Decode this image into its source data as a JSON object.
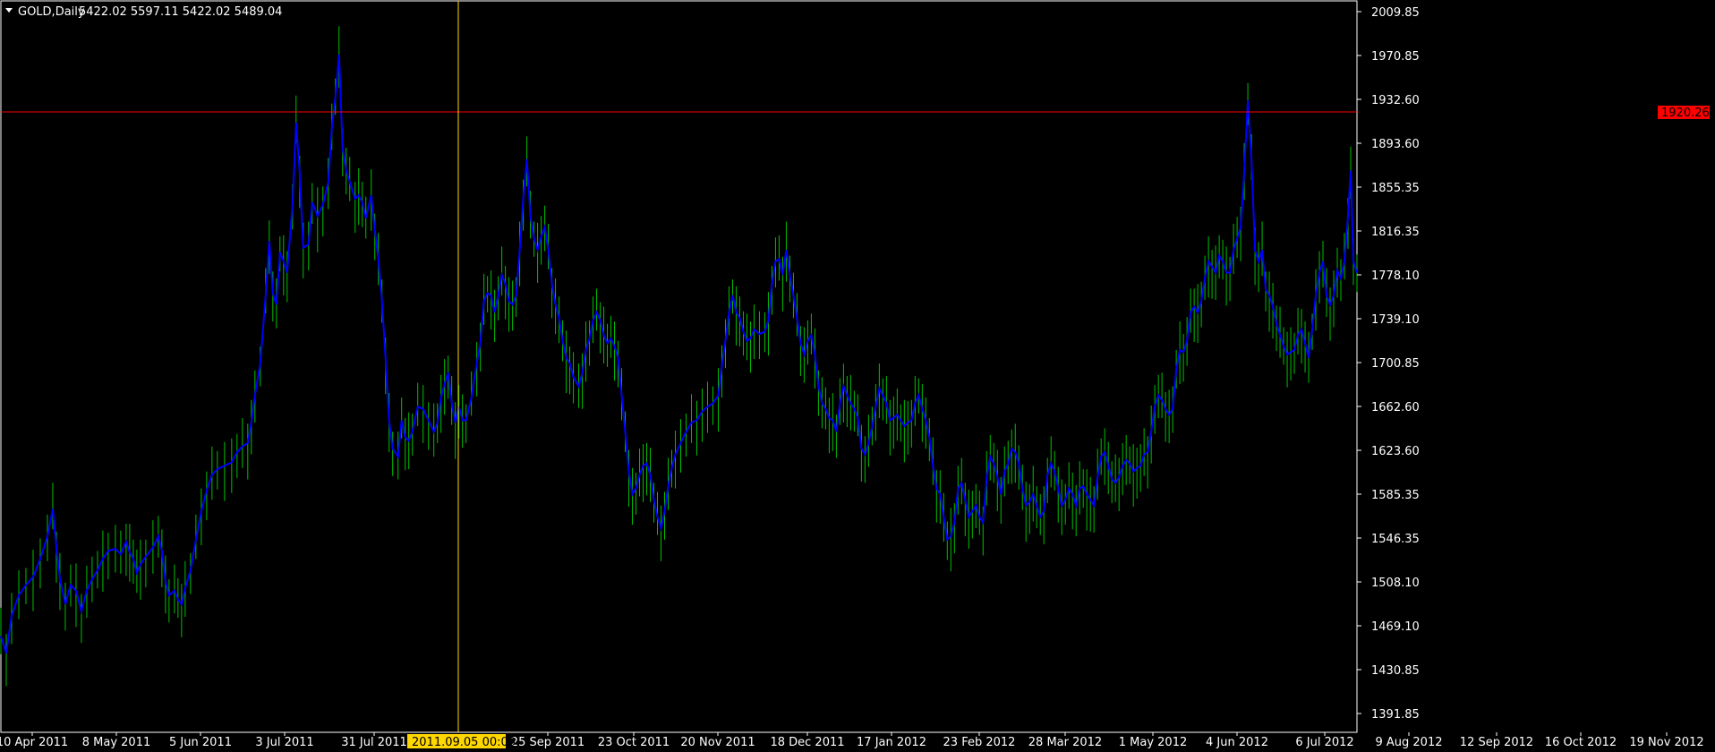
{
  "header": {
    "symbol_timeframe": "GOLD,Daily",
    "ohlc": "5422.02 5597.11 5422.02 5489.04"
  },
  "price_scale": {
    "ticks": [
      "2009.85",
      "1970.85",
      "1932.60",
      "1893.60",
      "1855.35",
      "1816.35",
      "1778.10",
      "1739.10",
      "1700.85",
      "1662.60",
      "1623.60",
      "1585.35",
      "1546.35",
      "1508.10",
      "1469.10",
      "1430.85",
      "1391.85"
    ]
  },
  "time_scale": {
    "ticks": [
      "10 Apr 2011",
      "8 May 2011",
      "5 Jun 2011",
      "3 Jul 2011",
      "31 Jul 2011",
      "25 Sep 2011",
      "23 Oct 2011",
      "20 Nov 2011",
      "18 Dec 2011",
      "17 Jan 2012",
      "23 Feb 2012",
      "28 Mar 2012",
      "1 May 2012",
      "4 Jun 2012",
      "6 Jul 2012",
      "9 Aug 2012",
      "12 Sep 2012",
      "16 Oct 2012",
      "19 Nov 2012"
    ]
  },
  "crosshair": {
    "price_label": "1920.26",
    "time_label": "2011.09.05 00:00"
  },
  "colors": {
    "background": "#000000",
    "axis": "#ffffff",
    "bars": "#00c000",
    "line": "#0000ff",
    "crosshair_h": "#ff0000",
    "crosshair_v": "#ffd700",
    "price_badge": "#ff0000",
    "time_badge": "#ffd700"
  },
  "chart_data": {
    "type": "line",
    "title": "GOLD,Daily",
    "x_start": "2011-04-01",
    "y_range": [
      1373,
      2020
    ],
    "path_points": [
      [
        0,
        1460
      ],
      [
        6,
        1445
      ],
      [
        12,
        1478
      ],
      [
        20,
        1496
      ],
      [
        28,
        1505
      ],
      [
        36,
        1512
      ],
      [
        44,
        1528
      ],
      [
        52,
        1548
      ],
      [
        58,
        1572
      ],
      [
        62,
        1538
      ],
      [
        66,
        1510
      ],
      [
        72,
        1488
      ],
      [
        78,
        1505
      ],
      [
        84,
        1500
      ],
      [
        90,
        1482
      ],
      [
        96,
        1500
      ],
      [
        102,
        1510
      ],
      [
        108,
        1518
      ],
      [
        114,
        1528
      ],
      [
        120,
        1535
      ],
      [
        128,
        1537
      ],
      [
        134,
        1532
      ],
      [
        140,
        1543
      ],
      [
        144,
        1534
      ],
      [
        148,
        1528
      ],
      [
        152,
        1516
      ],
      [
        156,
        1523
      ],
      [
        162,
        1530
      ],
      [
        170,
        1538
      ],
      [
        176,
        1548
      ],
      [
        180,
        1535
      ],
      [
        184,
        1508
      ],
      [
        188,
        1496
      ],
      [
        194,
        1500
      ],
      [
        198,
        1492
      ],
      [
        202,
        1488
      ],
      [
        206,
        1502
      ],
      [
        212,
        1518
      ],
      [
        218,
        1545
      ],
      [
        224,
        1570
      ],
      [
        230,
        1588
      ],
      [
        236,
        1602
      ],
      [
        242,
        1607
      ],
      [
        250,
        1610
      ],
      [
        258,
        1613
      ],
      [
        264,
        1622
      ],
      [
        270,
        1627
      ],
      [
        276,
        1630
      ],
      [
        280,
        1648
      ],
      [
        284,
        1672
      ],
      [
        290,
        1700
      ],
      [
        296,
        1760
      ],
      [
        300,
        1808
      ],
      [
        304,
        1762
      ],
      [
        308,
        1752
      ],
      [
        312,
        1798
      ],
      [
        316,
        1790
      ],
      [
        320,
        1780
      ],
      [
        326,
        1840
      ],
      [
        330,
        1912
      ],
      [
        334,
        1868
      ],
      [
        338,
        1802
      ],
      [
        344,
        1805
      ],
      [
        348,
        1842
      ],
      [
        354,
        1830
      ],
      [
        360,
        1840
      ],
      [
        366,
        1860
      ],
      [
        370,
        1908
      ],
      [
        374,
        1935
      ],
      [
        378,
        1972
      ],
      [
        382,
        1890
      ],
      [
        386,
        1870
      ],
      [
        390,
        1860
      ],
      [
        396,
        1845
      ],
      [
        400,
        1848
      ],
      [
        404,
        1842
      ],
      [
        408,
        1828
      ],
      [
        414,
        1848
      ],
      [
        418,
        1818
      ],
      [
        422,
        1792
      ],
      [
        426,
        1755
      ],
      [
        430,
        1705
      ],
      [
        434,
        1650
      ],
      [
        438,
        1625
      ],
      [
        444,
        1618
      ],
      [
        448,
        1650
      ],
      [
        452,
        1635
      ],
      [
        456,
        1632
      ],
      [
        460,
        1640
      ],
      [
        466,
        1662
      ],
      [
        472,
        1660
      ],
      [
        478,
        1650
      ],
      [
        484,
        1640
      ],
      [
        488,
        1648
      ],
      [
        492,
        1670
      ],
      [
        496,
        1682
      ],
      [
        500,
        1692
      ],
      [
        504,
        1665
      ],
      [
        508,
        1648
      ],
      [
        512,
        1662
      ],
      [
        516,
        1650
      ],
      [
        520,
        1650
      ],
      [
        526,
        1670
      ],
      [
        532,
        1700
      ],
      [
        536,
        1718
      ],
      [
        540,
        1755
      ],
      [
        544,
        1762
      ],
      [
        548,
        1760
      ],
      [
        552,
        1745
      ],
      [
        556,
        1760
      ],
      [
        560,
        1778
      ],
      [
        564,
        1770
      ],
      [
        568,
        1755
      ],
      [
        572,
        1752
      ],
      [
        576,
        1760
      ],
      [
        580,
        1800
      ],
      [
        584,
        1845
      ],
      [
        588,
        1880
      ],
      [
        592,
        1830
      ],
      [
        596,
        1810
      ],
      [
        600,
        1800
      ],
      [
        604,
        1812
      ],
      [
        608,
        1820
      ],
      [
        612,
        1800
      ],
      [
        616,
        1770
      ],
      [
        620,
        1752
      ],
      [
        624,
        1740
      ],
      [
        628,
        1720
      ],
      [
        632,
        1705
      ],
      [
        636,
        1700
      ],
      [
        640,
        1688
      ],
      [
        646,
        1680
      ],
      [
        650,
        1692
      ],
      [
        654,
        1712
      ],
      [
        658,
        1722
      ],
      [
        662,
        1738
      ],
      [
        666,
        1745
      ],
      [
        670,
        1738
      ],
      [
        674,
        1725
      ],
      [
        678,
        1718
      ],
      [
        682,
        1722
      ],
      [
        686,
        1715
      ],
      [
        690,
        1705
      ],
      [
        694,
        1672
      ],
      [
        698,
        1640
      ],
      [
        702,
        1605
      ],
      [
        706,
        1585
      ],
      [
        710,
        1590
      ],
      [
        714,
        1602
      ],
      [
        718,
        1610
      ],
      [
        722,
        1612
      ],
      [
        726,
        1602
      ],
      [
        730,
        1580
      ],
      [
        734,
        1565
      ],
      [
        738,
        1555
      ],
      [
        742,
        1570
      ],
      [
        746,
        1592
      ],
      [
        750,
        1608
      ],
      [
        754,
        1620
      ],
      [
        760,
        1630
      ],
      [
        766,
        1640
      ],
      [
        772,
        1648
      ],
      [
        778,
        1650
      ],
      [
        784,
        1658
      ],
      [
        790,
        1662
      ],
      [
        796,
        1665
      ],
      [
        802,
        1672
      ],
      [
        806,
        1698
      ],
      [
        810,
        1720
      ],
      [
        814,
        1745
      ],
      [
        818,
        1760
      ],
      [
        822,
        1745
      ],
      [
        826,
        1740
      ],
      [
        830,
        1728
      ],
      [
        834,
        1720
      ],
      [
        838,
        1722
      ],
      [
        842,
        1730
      ],
      [
        848,
        1726
      ],
      [
        854,
        1728
      ],
      [
        858,
        1738
      ],
      [
        862,
        1770
      ],
      [
        866,
        1790
      ],
      [
        870,
        1792
      ],
      [
        874,
        1778
      ],
      [
        878,
        1800
      ],
      [
        882,
        1778
      ],
      [
        886,
        1760
      ],
      [
        890,
        1740
      ],
      [
        894,
        1718
      ],
      [
        898,
        1708
      ],
      [
        902,
        1720
      ],
      [
        906,
        1725
      ],
      [
        910,
        1708
      ],
      [
        914,
        1680
      ],
      [
        918,
        1665
      ],
      [
        922,
        1660
      ],
      [
        926,
        1652
      ],
      [
        930,
        1650
      ],
      [
        934,
        1640
      ],
      [
        938,
        1665
      ],
      [
        942,
        1680
      ],
      [
        946,
        1672
      ],
      [
        950,
        1665
      ],
      [
        954,
        1660
      ],
      [
        958,
        1652
      ],
      [
        962,
        1625
      ],
      [
        966,
        1620
      ],
      [
        970,
        1630
      ],
      [
        974,
        1645
      ],
      [
        978,
        1662
      ],
      [
        982,
        1678
      ],
      [
        986,
        1672
      ],
      [
        990,
        1665
      ],
      [
        994,
        1650
      ],
      [
        998,
        1652
      ],
      [
        1002,
        1655
      ],
      [
        1006,
        1650
      ],
      [
        1010,
        1645
      ],
      [
        1014,
        1648
      ],
      [
        1018,
        1650
      ],
      [
        1022,
        1665
      ],
      [
        1026,
        1672
      ],
      [
        1030,
        1660
      ],
      [
        1034,
        1650
      ],
      [
        1038,
        1635
      ],
      [
        1042,
        1610
      ],
      [
        1046,
        1590
      ],
      [
        1050,
        1585
      ],
      [
        1054,
        1565
      ],
      [
        1058,
        1545
      ],
      [
        1062,
        1548
      ],
      [
        1066,
        1560
      ],
      [
        1070,
        1590
      ],
      [
        1074,
        1595
      ],
      [
        1078,
        1580
      ],
      [
        1082,
        1565
      ],
      [
        1086,
        1570
      ],
      [
        1090,
        1575
      ],
      [
        1094,
        1565
      ],
      [
        1098,
        1560
      ],
      [
        1102,
        1600
      ],
      [
        1106,
        1618
      ],
      [
        1110,
        1612
      ],
      [
        1114,
        1600
      ],
      [
        1118,
        1585
      ],
      [
        1122,
        1605
      ],
      [
        1126,
        1612
      ],
      [
        1130,
        1625
      ],
      [
        1134,
        1622
      ],
      [
        1138,
        1612
      ],
      [
        1142,
        1590
      ],
      [
        1146,
        1575
      ],
      [
        1150,
        1578
      ],
      [
        1154,
        1585
      ],
      [
        1158,
        1575
      ],
      [
        1162,
        1565
      ],
      [
        1166,
        1570
      ],
      [
        1170,
        1602
      ],
      [
        1174,
        1612
      ],
      [
        1178,
        1605
      ],
      [
        1182,
        1590
      ],
      [
        1186,
        1575
      ],
      [
        1190,
        1580
      ],
      [
        1194,
        1590
      ],
      [
        1198,
        1585
      ],
      [
        1202,
        1575
      ],
      [
        1206,
        1590
      ],
      [
        1210,
        1592
      ],
      [
        1214,
        1585
      ],
      [
        1218,
        1580
      ],
      [
        1222,
        1575
      ],
      [
        1226,
        1600
      ],
      [
        1230,
        1618
      ],
      [
        1234,
        1622
      ],
      [
        1238,
        1610
      ],
      [
        1242,
        1598
      ],
      [
        1246,
        1595
      ],
      [
        1250,
        1600
      ],
      [
        1254,
        1610
      ],
      [
        1258,
        1615
      ],
      [
        1262,
        1612
      ],
      [
        1266,
        1605
      ],
      [
        1270,
        1608
      ],
      [
        1274,
        1610
      ],
      [
        1278,
        1620
      ],
      [
        1282,
        1622
      ],
      [
        1286,
        1640
      ],
      [
        1290,
        1662
      ],
      [
        1294,
        1672
      ],
      [
        1298,
        1668
      ],
      [
        1302,
        1660
      ],
      [
        1306,
        1655
      ],
      [
        1310,
        1660
      ],
      [
        1314,
        1695
      ],
      [
        1318,
        1712
      ],
      [
        1322,
        1710
      ],
      [
        1326,
        1720
      ],
      [
        1330,
        1745
      ],
      [
        1334,
        1750
      ],
      [
        1338,
        1745
      ],
      [
        1342,
        1755
      ],
      [
        1346,
        1775
      ],
      [
        1350,
        1790
      ],
      [
        1354,
        1785
      ],
      [
        1358,
        1780
      ],
      [
        1362,
        1795
      ],
      [
        1366,
        1790
      ],
      [
        1370,
        1780
      ],
      [
        1374,
        1780
      ],
      [
        1378,
        1800
      ],
      [
        1382,
        1810
      ],
      [
        1386,
        1820
      ],
      [
        1390,
        1870
      ],
      [
        1394,
        1932
      ],
      [
        1398,
        1880
      ],
      [
        1402,
        1800
      ],
      [
        1406,
        1790
      ],
      [
        1410,
        1800
      ],
      [
        1414,
        1765
      ],
      [
        1418,
        1760
      ],
      [
        1422,
        1750
      ],
      [
        1426,
        1735
      ],
      [
        1430,
        1725
      ],
      [
        1434,
        1715
      ],
      [
        1438,
        1708
      ],
      [
        1442,
        1710
      ],
      [
        1446,
        1712
      ],
      [
        1450,
        1725
      ],
      [
        1454,
        1730
      ],
      [
        1458,
        1718
      ],
      [
        1462,
        1705
      ],
      [
        1466,
        1730
      ],
      [
        1470,
        1760
      ],
      [
        1474,
        1780
      ],
      [
        1478,
        1790
      ],
      [
        1482,
        1760
      ],
      [
        1486,
        1752
      ],
      [
        1490,
        1760
      ],
      [
        1494,
        1782
      ],
      [
        1498,
        1775
      ],
      [
        1502,
        1790
      ],
      [
        1506,
        1830
      ],
      [
        1509,
        1870
      ],
      [
        1512,
        1790
      ],
      [
        1516,
        1780
      ]
    ]
  }
}
